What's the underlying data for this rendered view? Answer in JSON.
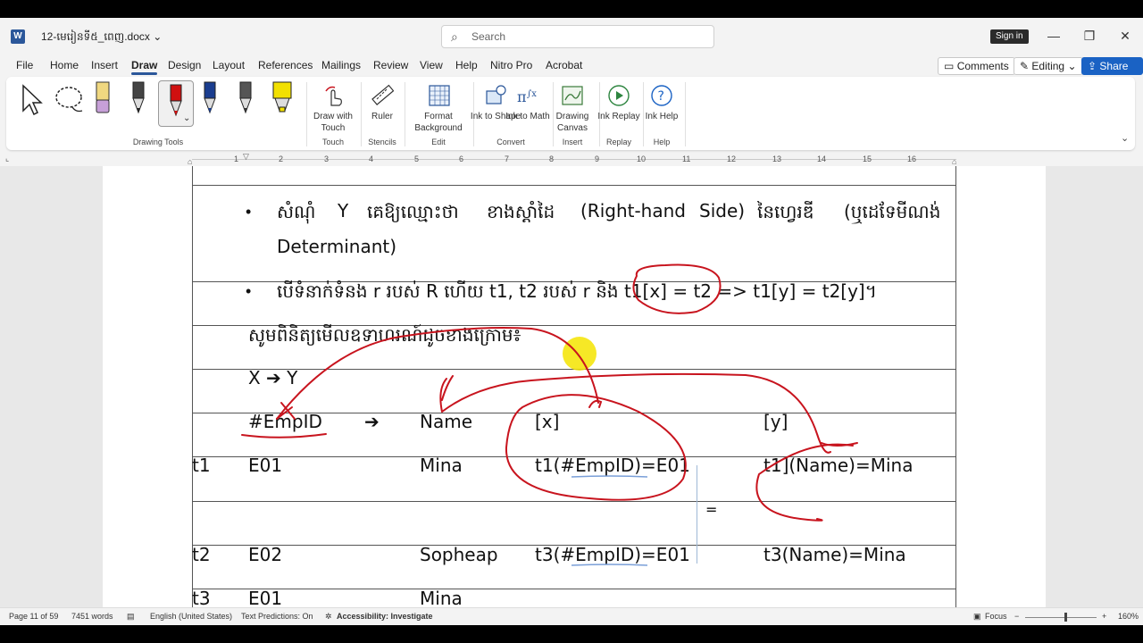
{
  "window": {
    "doc_title": "12-មេរៀនទី៥_ពេញ.docx",
    "search_placeholder": "Search",
    "sign_in": "Sign in",
    "app_icon_letter": "W",
    "minimize_glyph": "—",
    "restore_glyph": "❐",
    "close_glyph": "✕"
  },
  "menu": {
    "items": [
      "File",
      "Home",
      "Insert",
      "Draw",
      "Design",
      "Layout",
      "References",
      "Mailings",
      "Review",
      "View",
      "Help",
      "Nitro Pro",
      "Acrobat"
    ],
    "active": "Draw",
    "comments": "Comments",
    "editing": "Editing",
    "share": "Share"
  },
  "ribbon": {
    "groups": {
      "drawing_tools": "Drawing Tools",
      "touch": "Touch",
      "stencils": "Stencils",
      "edit": "Edit",
      "convert": "Convert",
      "insert": "Insert",
      "replay": "Replay",
      "help": "Help"
    },
    "buttons": {
      "draw_with_touch": "Draw with Touch",
      "ruler": "Ruler",
      "format_background": "Format Background",
      "ink_to_shape": "Ink to Shape",
      "ink_to_math": "Ink to Math",
      "drawing_canvas": "Drawing Canvas",
      "ink_replay": "Ink Replay",
      "ink_help": "Ink Help"
    },
    "pen_colors": [
      "#222222",
      "#e8d060",
      "#222222",
      "#d01010",
      "#1a3d8f",
      "#333333",
      "#f2e000"
    ]
  },
  "ruler": {
    "numbers": [
      "1",
      "2",
      "3",
      "4",
      "5",
      "6",
      "7",
      "8",
      "9",
      "10",
      "11",
      "12",
      "13",
      "14",
      "15",
      "16"
    ]
  },
  "document": {
    "bullet1_line1_parts": [
      "សំណុំ",
      "Y",
      "គេឱ្យឈ្មោះថា",
      "ខាងស្ដាំដៃ",
      "(Right-hand",
      "Side)",
      "នៃហ្វេរឌី",
      "(ឬដេទែមីណង់"
    ],
    "bullet1_line2": "Determinant)",
    "bullet2": "បើទំនាក់ទំនង r របស់ R ហើយ t1, t2 របស់ r និង t1[x] = t2 => t1[y] = t2[y]។",
    "example_intro": "សូមពិនិត្យមើលឧទាហរណ៍ដូចខាងក្រោម៖",
    "fd": "X ➔ Y",
    "header": {
      "empid": "#EmpID",
      "arrow": "➔",
      "name": "Name",
      "x": "[x]",
      "y": "[y]"
    },
    "rows": [
      {
        "label": "t1",
        "id": "E01",
        "name": "Mina",
        "x_expr": "t1(#EmpID)=E01",
        "y_expr": "t1](Name)=Mina"
      },
      {
        "label": "t2",
        "id": "E02",
        "name": "Sopheap",
        "x_expr": "t3(#EmpID)=E01",
        "y_expr": "t3(Name)=Mina"
      },
      {
        "label": "t3",
        "id": "E01",
        "name": "Mina",
        "x_expr": "",
        "y_expr": ""
      }
    ],
    "equals_sign": "="
  },
  "status": {
    "page": "Page 11 of 59",
    "words": "7451 words",
    "language": "English (United States)",
    "predictions": "Text Predictions: On",
    "accessibility": "Accessibility: Investigate",
    "focus": "Focus",
    "zoom": "160%"
  },
  "colors": {
    "accent": "#2b579a",
    "share": "#1a62c4",
    "ink": "#c8141e",
    "highlight": "#f5e400"
  }
}
